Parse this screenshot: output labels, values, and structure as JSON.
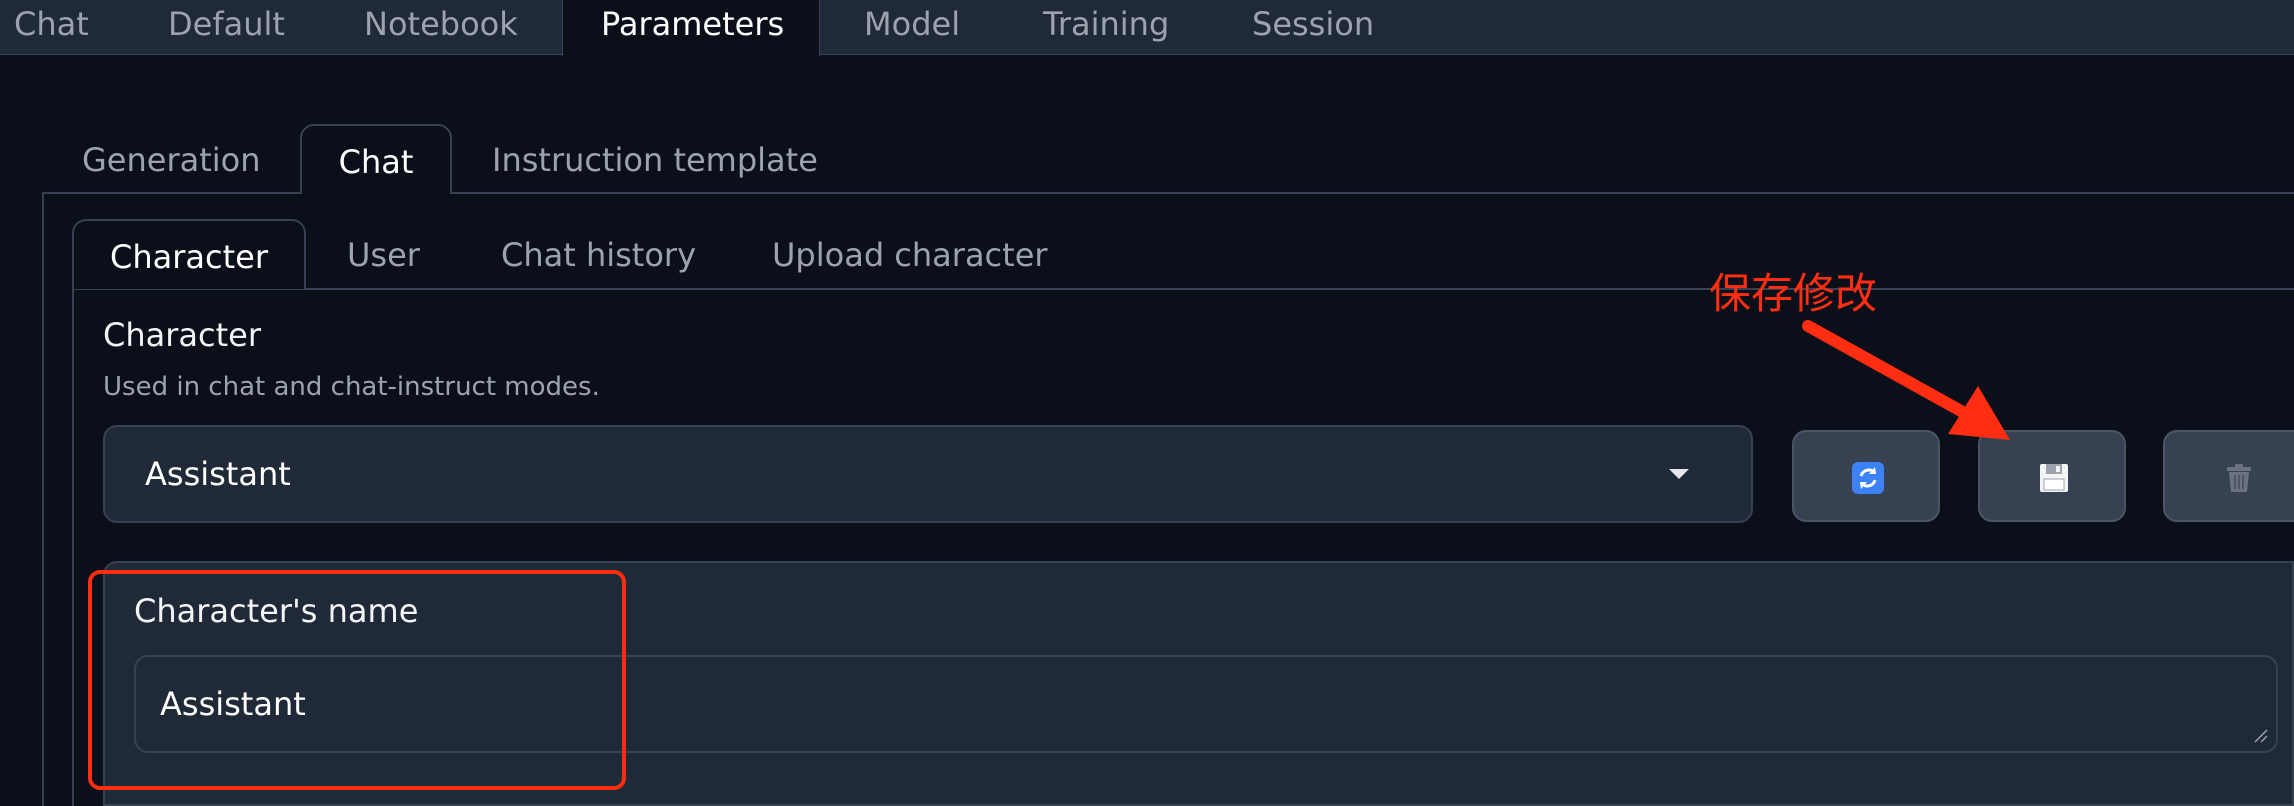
{
  "top_tabs": [
    {
      "label": "Chat"
    },
    {
      "label": "Default"
    },
    {
      "label": "Notebook"
    },
    {
      "label": "Parameters",
      "active": true
    },
    {
      "label": "Model"
    },
    {
      "label": "Training"
    },
    {
      "label": "Session"
    }
  ],
  "parameters_tabs": [
    {
      "label": "Generation"
    },
    {
      "label": "Chat",
      "active": true
    },
    {
      "label": "Instruction template"
    }
  ],
  "chat_tabs": [
    {
      "label": "Character",
      "active": true
    },
    {
      "label": "User"
    },
    {
      "label": "Chat history"
    },
    {
      "label": "Upload character"
    }
  ],
  "character": {
    "label": "Character",
    "info": "Used in chat and chat-instruct modes.",
    "selected": "Assistant"
  },
  "buttons": [
    {
      "icon": "refresh-icon"
    },
    {
      "icon": "save-icon"
    },
    {
      "icon": "trash-icon"
    }
  ],
  "fields": {
    "name_label": "Character's name",
    "name_value": "Assistant"
  },
  "annotation": {
    "text": "保存修改",
    "color": "#ff2d12"
  },
  "colors": {
    "background": "#0b0f19",
    "panel": "#1f2937",
    "border": "#374151",
    "button": "#374151"
  }
}
